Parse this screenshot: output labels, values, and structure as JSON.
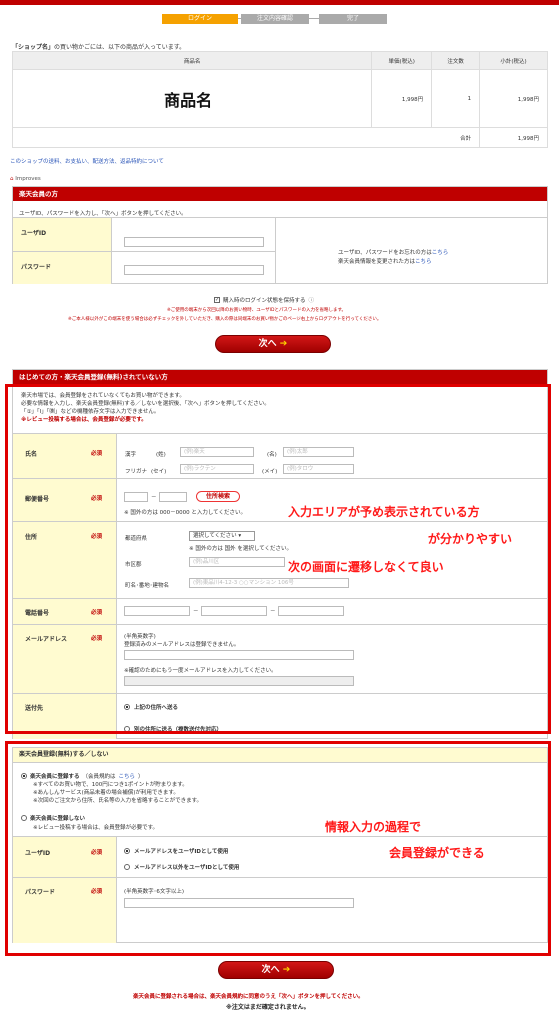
{
  "steps": [
    "ログイン",
    "注文内容確認",
    "完了"
  ],
  "cart": {
    "intro_shop": "「ショップ名」",
    "intro_rest": "の買い物かごには、以下の商品が入っています。",
    "headers": [
      "商品名",
      "単価(税込)",
      "注文数",
      "小計(税込)"
    ],
    "product_name": "商品名",
    "unit_price": "1,998円",
    "qty": "1",
    "subtotal": "1,998円",
    "total_label": "合計",
    "total_value": "1,998円"
  },
  "shop_links": "このショップの送料、お支払い、配送方法、返品特約について",
  "improves": "Improves",
  "member": {
    "title": "楽天会員の方",
    "instruction": "ユーザID、パスワードを入力し、「次へ」ボタンを押してください。",
    "userid_label": "ユーザID",
    "password_label": "パスワード",
    "forgot_text": "ユーザID、パスワードをお忘れの方は",
    "forgot_link": "こちら",
    "changed_text": "楽天会員情報を変更された方は",
    "changed_link": "こちら",
    "keep_login": "購入時のログイン状態を保持する",
    "note1": "※ご使用の端末から次回以降のお買い物時、ユーザIDとパスワードの入力を省略します。",
    "note2": "※ご本人様以外がこの端末を使う場合は必ずチェックを外していただき、購入の際は同端末のお買い物かごのページ右上からログアウトを行ってください。",
    "next_label": "次へ"
  },
  "guest": {
    "title": "はじめての方・楽天会員登録(無料)されていない方",
    "desc1": "楽天市場では、会員登録をされていなくてもお買い物ができます。",
    "desc2": "必要な情報を入力し、楽天会員登録(無料)する／しないを選択後、「次へ」ボタンを押してください。",
    "desc3": "「①」「Ⅰ」「㈱」などの機種依存文字は入力できません。",
    "desc_red": "※レビュー投稿する場合は、会員登録が必要です。",
    "required": "必須",
    "name_label": "氏名",
    "kanji": "漢字",
    "sei": "(姓)",
    "mei": "(名)",
    "sei_ph": "(例)楽天",
    "mei_ph": "(例)太郎",
    "furigana": "フリガナ",
    "sei_kana": "(セイ)",
    "mei_kana": "(メイ)",
    "sei_kana_ph": "(例)ラクテン",
    "mei_kana_ph": "(例)タロウ",
    "zip_label": "郵便番号",
    "zip_btn": "住所検索",
    "zip_note": "※ 国外の方は 000－0000 と入力してください。",
    "addr_label": "住所",
    "pref": "都道府県",
    "pref_value": "選択してください",
    "pref_note": "※ 国外の方は 国外 を選択してください。",
    "city": "市区郡",
    "city_ph": "(例)品川区",
    "street": "町名･番地･建物名",
    "street_ph": "(例)東品川4-12-3 ○○マンション 106号",
    "tel_label": "電話番号",
    "mail_label": "メールアドレス",
    "mail_note1": "(半角英数字)",
    "mail_note2": "登録済みのメールアドレスは登録できません。",
    "mail_confirm_note": "※確認のためにもう一度メールアドレスを入力してください。",
    "ship_label": "送付先",
    "ship_opt1": "上記の住所へ送る",
    "ship_opt2": "別の住所に送る（複数送付先対応）"
  },
  "register": {
    "title": "楽天会員登録(無料)する／しない",
    "opt_yes": "楽天会員に登録する",
    "opt_yes_paren_open": "（会員規約は",
    "opt_yes_link": "こちら",
    "opt_yes_paren_close": "）",
    "yes_note1": "※すべてのお買い物で、100円につき1ポイントが貯まります。",
    "yes_note2": "※あんしんサービス(商品未着の場合補償)が利用できます。",
    "yes_note3": "※次回のご注文から住所、氏名等の入力を省略することができます。",
    "opt_no": "楽天会員に登録しない",
    "no_note": "※レビュー投稿する場合は、会員登録が必要です。",
    "userid_label": "ユーザID",
    "uid_opt1": "メールアドレスをユーザIDとして使用",
    "uid_opt2": "メールアドレス以外をユーザIDとして使用",
    "pw_label": "パスワード",
    "pw_note": "(半角英数字･6文字以上)"
  },
  "annotations": {
    "a1": "入力エリアが予め表示されている方",
    "a2": "が分かりやすい",
    "a3": "次の画面に遷移しなくて良い",
    "a4": "情報入力の過程で",
    "a5": "会員登録ができる"
  },
  "footer": {
    "next_label": "次へ",
    "note_red": "楽天会員に登録される場合は、楽天会員規約に同意のうえ「次へ」ボタンを押してください。",
    "note_black": "※注文はまだ確定されません。"
  }
}
